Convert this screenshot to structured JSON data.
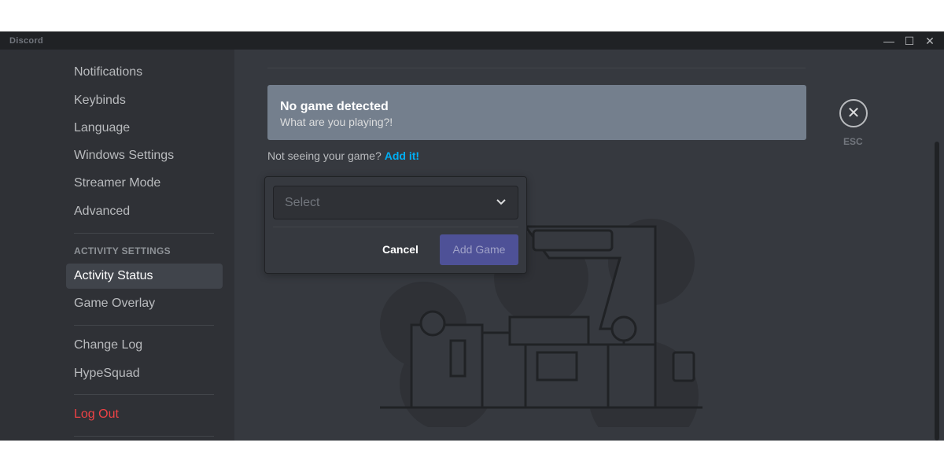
{
  "window": {
    "title": "Discord",
    "controls": [
      "minimize",
      "maximize",
      "close"
    ]
  },
  "sidebar": {
    "items": [
      {
        "label": "Notifications"
      },
      {
        "label": "Keybinds"
      },
      {
        "label": "Language"
      },
      {
        "label": "Windows Settings"
      },
      {
        "label": "Streamer Mode"
      },
      {
        "label": "Advanced"
      }
    ],
    "activity_header": "ACTIVITY SETTINGS",
    "activity_items": [
      {
        "label": "Activity Status",
        "selected": true
      },
      {
        "label": "Game Overlay"
      }
    ],
    "misc_items": [
      {
        "label": "Change Log"
      },
      {
        "label": "HypeSquad"
      }
    ],
    "logout": "Log Out"
  },
  "main": {
    "banner": {
      "title": "No game detected",
      "subtitle": "What are you playing?!"
    },
    "hint": {
      "text": "Not seeing your game?",
      "link": "Add it!"
    },
    "esc_label": "ESC",
    "popup": {
      "select_placeholder": "Select",
      "cancel": "Cancel",
      "add_game": "Add Game"
    }
  },
  "colors": {
    "accent": "#5865f2",
    "link": "#00aff4",
    "danger": "#ed4245",
    "banner": "#747f8d"
  }
}
